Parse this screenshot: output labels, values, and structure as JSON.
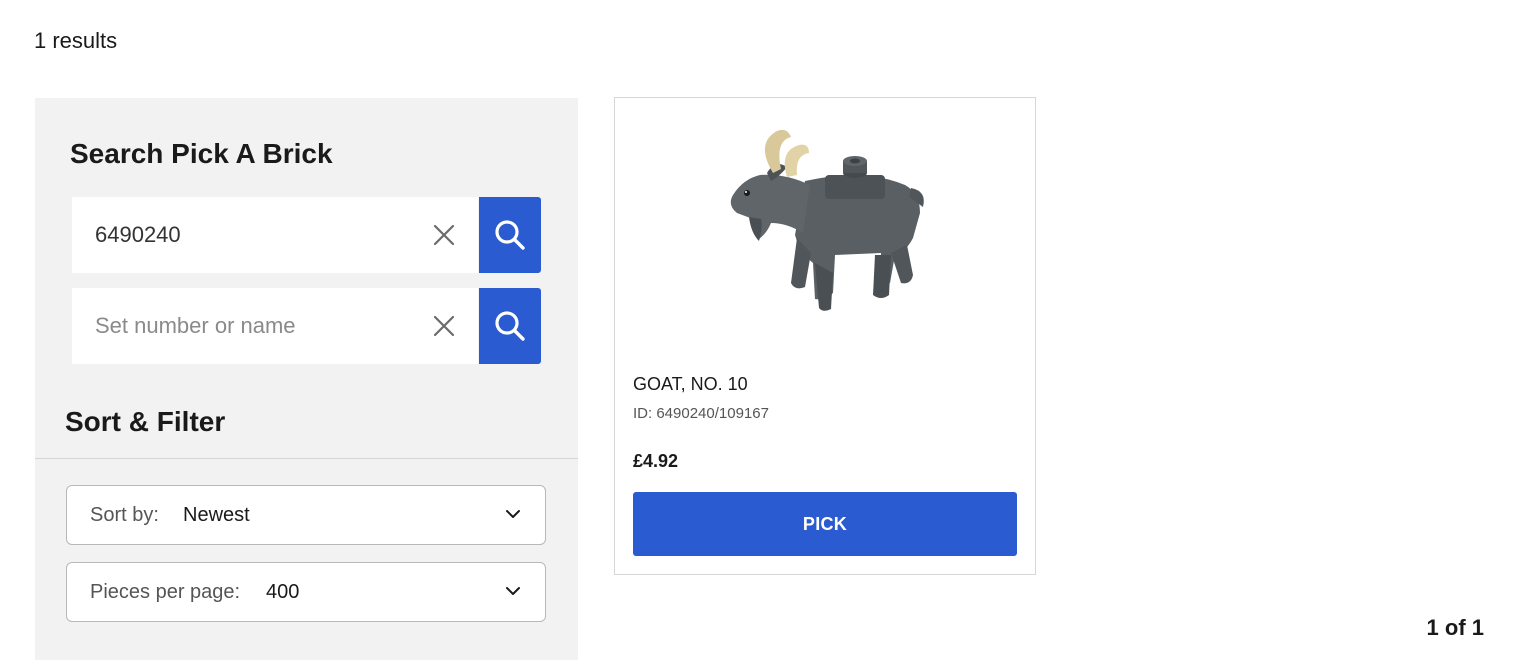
{
  "results": {
    "count_text": "1 results"
  },
  "sidebar": {
    "title": "Search Pick A Brick",
    "part_search": {
      "value": "6490240",
      "placeholder": ""
    },
    "set_search": {
      "value": "",
      "placeholder": "Set number or name"
    },
    "sort_filter_title": "Sort & Filter",
    "sort": {
      "label": "Sort by:",
      "value": "Newest"
    },
    "per_page": {
      "label": "Pieces per page:",
      "value": "400"
    }
  },
  "product": {
    "name": "GOAT, NO. 10",
    "id_text": "ID: 6490240/109167",
    "price": "£4.92",
    "pick_label": "PICK",
    "image_icon": "goat-brick-icon"
  },
  "pagination": {
    "text": "1 of 1"
  },
  "colors": {
    "accent": "#2a5bd0",
    "sidebar_bg": "#f2f2f2",
    "goat_body": "#5a5f63",
    "goat_horns": "#d9c99a"
  }
}
